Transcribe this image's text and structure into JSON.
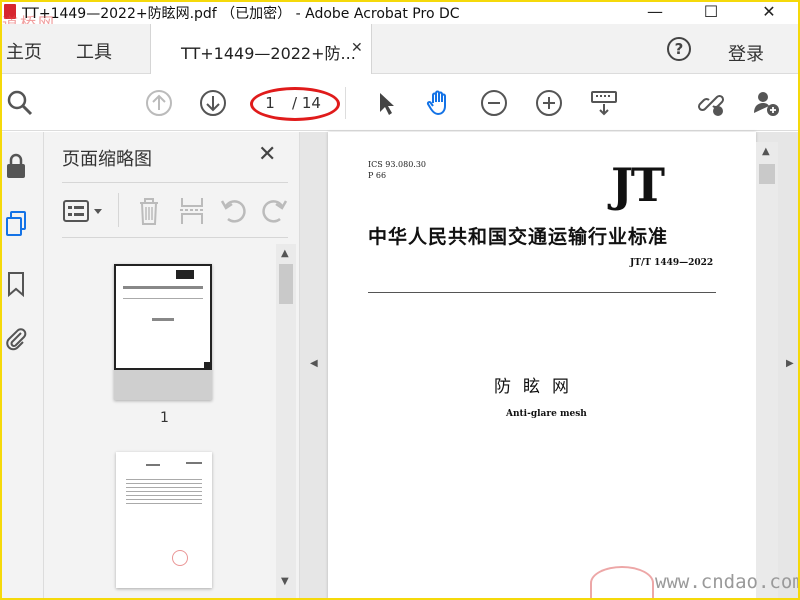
{
  "window": {
    "title": "TT+1449—2022+防眩网.pdf （已加密） - Adobe Acrobat Pro DC",
    "minimize": "—",
    "maximize": "☐",
    "close": "✕"
  },
  "watermark_top": "道桥网",
  "tabs": {
    "home": "主页",
    "tools": "工具",
    "document": "TT+1449—2022+防...",
    "document_close": "✕",
    "help": "?",
    "login": "登录"
  },
  "toolbar": {
    "current_page": "1",
    "total_pages": "/ 14",
    "highlight_color": "#e01b1b",
    "icons": [
      "search-icon",
      "prev-page-icon",
      "next-page-icon",
      "select-cursor-icon",
      "hand-tool-icon",
      "zoom-out-icon",
      "zoom-in-icon",
      "keyboard-tools-icon",
      "share-link-icon",
      "add-user-icon"
    ]
  },
  "panel": {
    "title": "页面缩略图",
    "close": "✕",
    "thumbnails": [
      {
        "number": "1"
      }
    ]
  },
  "document": {
    "ics": "ICS 93.080.30",
    "p_code": "P 66",
    "logo": "JT",
    "organization": "中华人民共和国交通运输行业标准",
    "standard_code": "JT/T 1449—2022",
    "title_cn": "防眩网",
    "title_en": "Anti-glare mesh"
  },
  "watermark_bottom": "www.cndao.com",
  "colors": {
    "accent": "#1473e6",
    "frame": "#f5d90a"
  }
}
